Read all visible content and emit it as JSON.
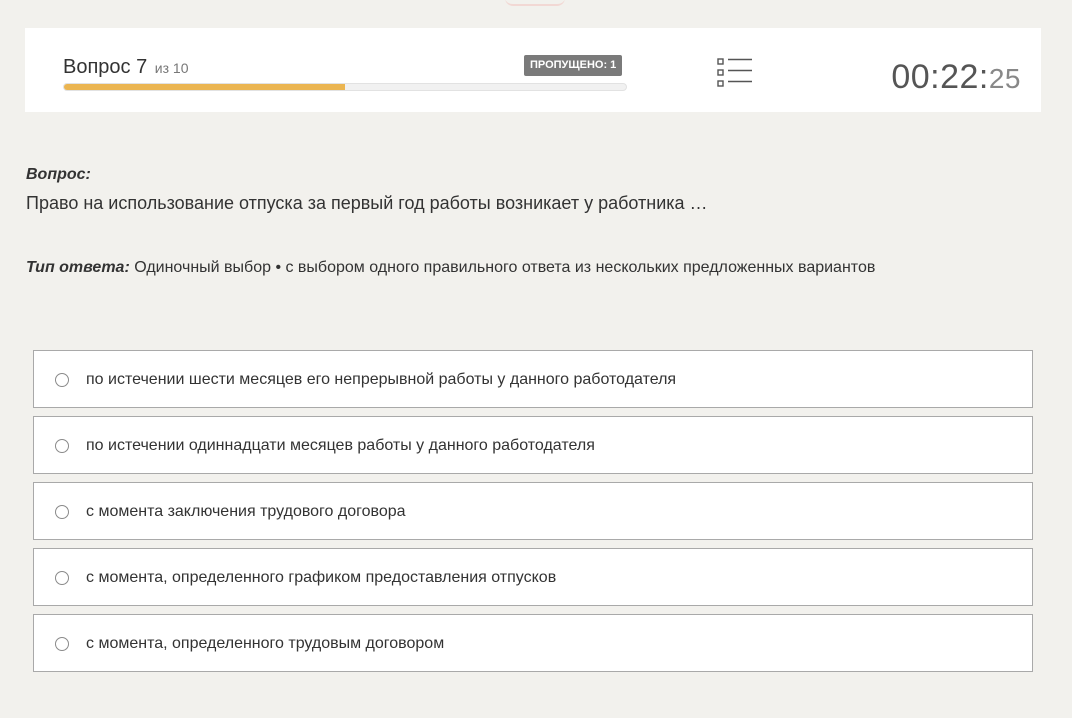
{
  "header": {
    "question_label": "Вопрос 7",
    "question_of": "из 10",
    "skipped_badge": "ПРОПУЩЕНО: 1",
    "progress_fraction": 0.5,
    "timer_main": "00:22:",
    "timer_seconds": "25",
    "list_icon": "list-icon"
  },
  "question": {
    "label": "Вопрос:",
    "text": "Право на использование отпуска за первый год работы возникает у работника …"
  },
  "answer_type": {
    "label": "Тип ответа:",
    "value": " Одиночный выбор • с выбором одного правильного ответа из нескольких предложенных вариантов"
  },
  "options": [
    {
      "label": "по истечении шести месяцев его непрерывной работы у данного работодателя"
    },
    {
      "label": "по истечении одиннадцати месяцев работы у данного работодателя"
    },
    {
      "label": "с момента заключения трудового договора"
    },
    {
      "label": "с момента, определенного графиком предоставления отпусков"
    },
    {
      "label": "с момента, определенного трудовым договором"
    }
  ],
  "colors": {
    "progress": "#ebb551",
    "badge": "#7a7a7a",
    "background": "#f2f1ed"
  }
}
